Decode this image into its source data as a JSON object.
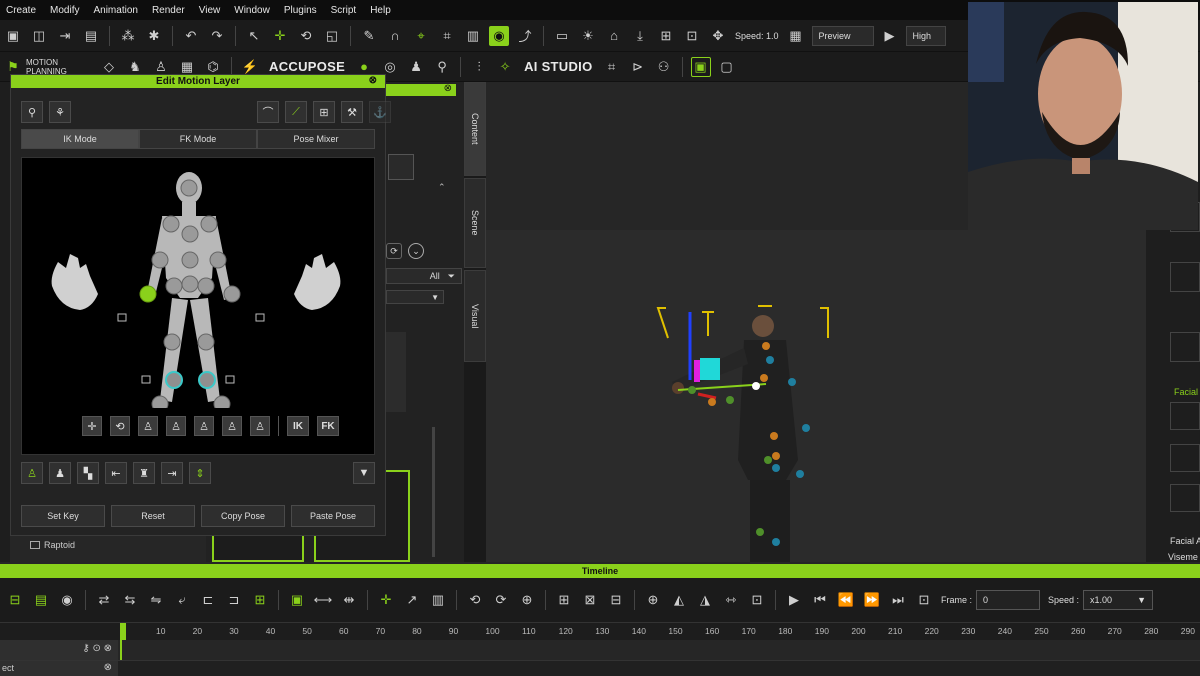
{
  "menu": [
    "Create",
    "Modify",
    "Animation",
    "Render",
    "View",
    "Window",
    "Plugins",
    "Script",
    "Help"
  ],
  "toolbar": {
    "speed_label": "Speed: 1.0",
    "preview_label": "Preview",
    "quality_label": "High",
    "motion_planning_line1": "MOTION",
    "motion_planning_line2": "PLANNING",
    "accupose_label": "ACCUPOSE",
    "ai_studio_label": "AI STUDIO"
  },
  "side_tabs": [
    "Content",
    "Scene",
    "Visual"
  ],
  "panel": {
    "all_label": "All"
  },
  "edit_motion_layer": {
    "title": "Edit Motion Layer",
    "close_icon": "close-icon",
    "tabs": [
      {
        "label": "IK Mode",
        "active": true
      },
      {
        "label": "FK Mode",
        "active": false
      },
      {
        "label": "Pose Mixer",
        "active": false
      }
    ],
    "ik_label": "IK",
    "fk_label": "FK",
    "buttons": {
      "set_key": "Set Key",
      "reset": "Reset",
      "copy_pose": "Copy Pose",
      "paste_pose": "Paste Pose"
    }
  },
  "tree": {
    "raptoid": "Raptoid"
  },
  "right_panel": {
    "facial_label": "Facial",
    "facial_a_label": "Facial A",
    "viseme_label": "Viseme"
  },
  "timeline": {
    "title": "Timeline",
    "frame_label": "Frame :",
    "frame_value": "0",
    "speed_label": "Speed :",
    "speed_value": "x1.00",
    "ticks": [
      "10",
      "20",
      "30",
      "40",
      "50",
      "60",
      "70",
      "80",
      "90",
      "100",
      "110",
      "120",
      "130",
      "140",
      "150",
      "160",
      "170",
      "180",
      "190",
      "200",
      "210",
      "220",
      "230",
      "240",
      "250",
      "260",
      "270",
      "280",
      "290"
    ],
    "track_label": "ect"
  },
  "colors": {
    "accent": "#8ad11b",
    "ik_joint_cyan": "#3cc8c8",
    "dot_blue": "#1f7f9f",
    "dot_orange": "#c97a1e",
    "dot_green": "#4f8f2a"
  }
}
